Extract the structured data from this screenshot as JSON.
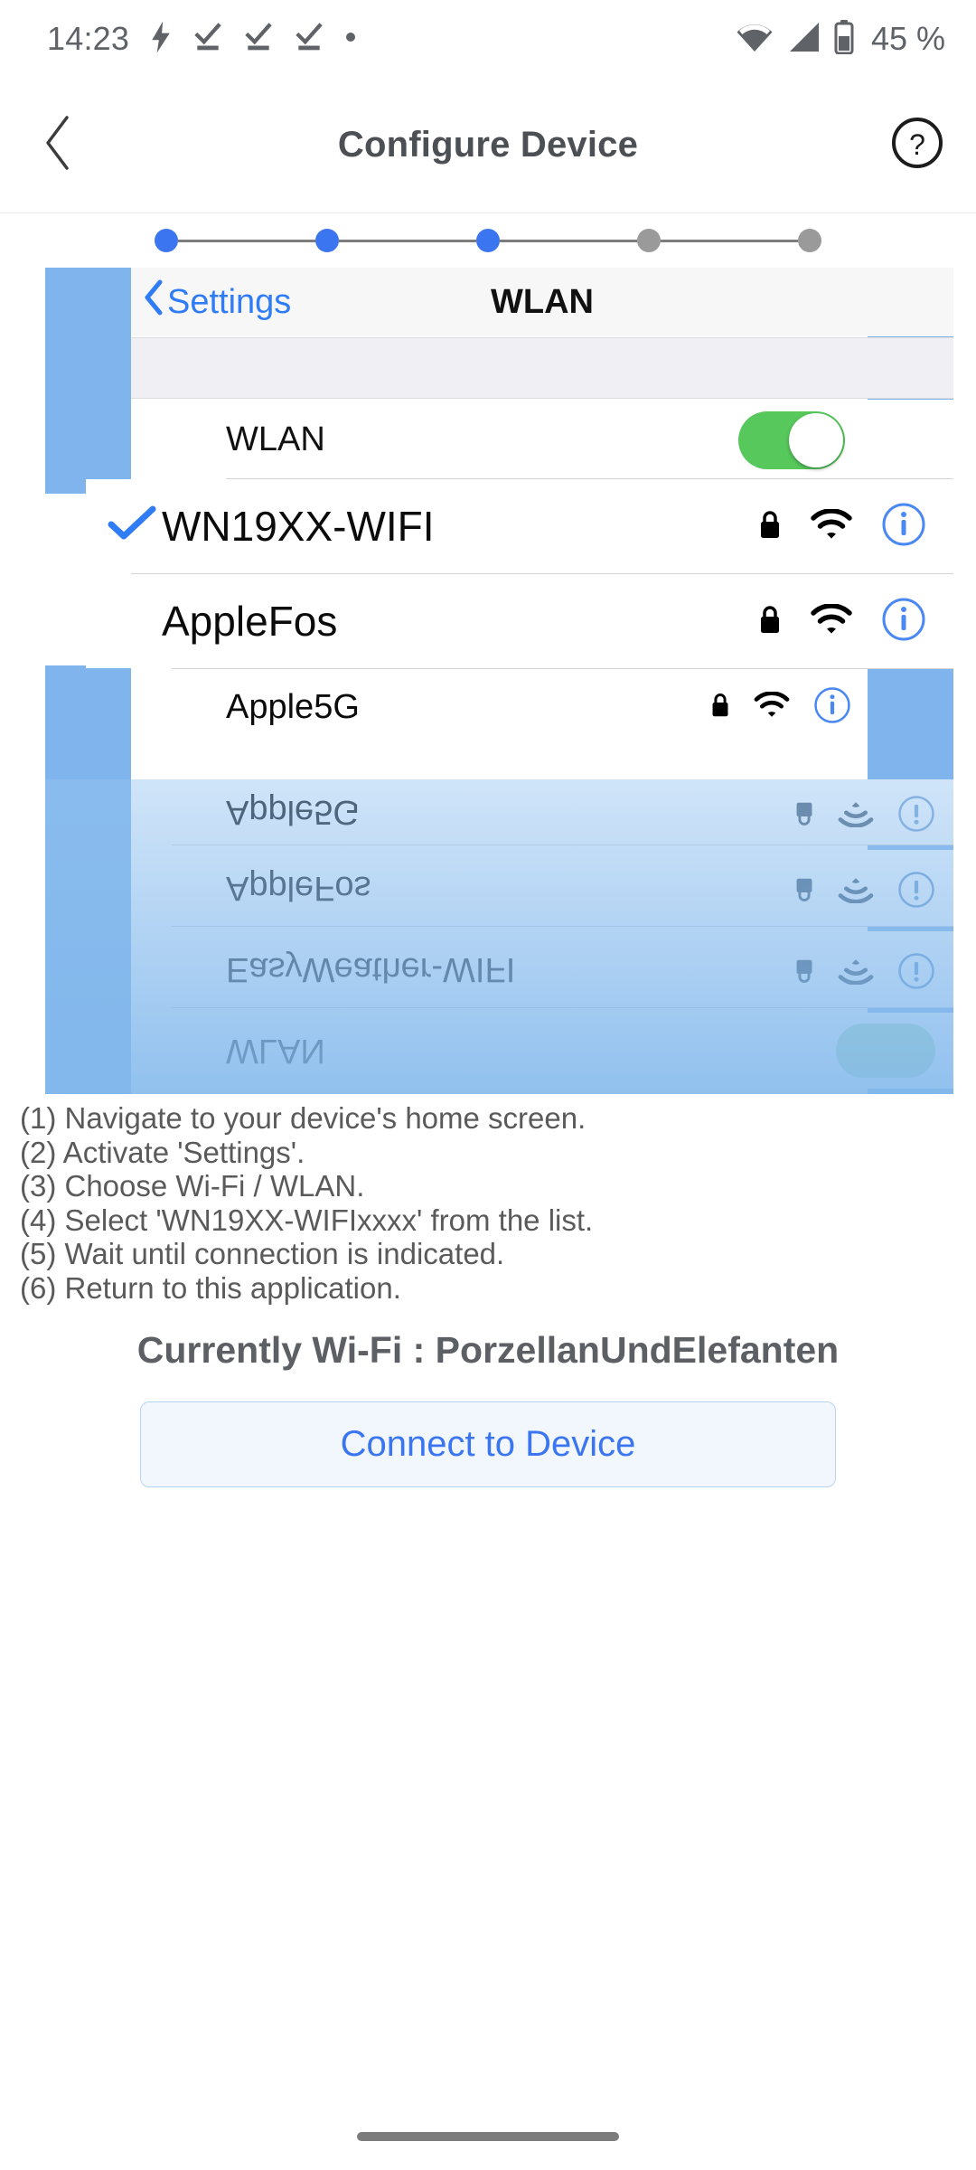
{
  "status_bar": {
    "time": "14:23",
    "battery_text": "45 %",
    "icons": [
      "charging-bolt-icon",
      "task-check-icon",
      "task-check-icon",
      "task-check-icon",
      "dot-icon",
      "wifi-icon",
      "cellular-signal-icon",
      "battery-icon"
    ]
  },
  "app_bar": {
    "back_icon": "chevron-left-icon",
    "title": "Configure Device",
    "help_icon": "help-circle-icon"
  },
  "stepper": {
    "total": 5,
    "active": 3,
    "states": [
      "on",
      "on",
      "on",
      "off",
      "off"
    ],
    "colors": {
      "active": "#3b76f0",
      "inactive": "#9a9a9a"
    }
  },
  "tutorial_image": {
    "ios_nav": {
      "back_label": "Settings",
      "title": "WLAN"
    },
    "wlan_row": {
      "label": "WLAN",
      "toggle_state": "on",
      "toggle_color": "#57c85c"
    },
    "networks": [
      {
        "ssid": "WN19XX-WIFI",
        "connected": true,
        "locked": true,
        "signal": "wifi-full-icon",
        "info": "info-circle-icon"
      },
      {
        "ssid": "AppleFos",
        "connected": false,
        "locked": true,
        "signal": "wifi-full-icon",
        "info": "info-circle-icon"
      },
      {
        "ssid": "Apple5G",
        "connected": false,
        "locked": true,
        "signal": "wifi-full-icon",
        "info": "info-circle-icon"
      }
    ],
    "reflection_networks": [
      {
        "ssid": "Apple5G"
      },
      {
        "ssid": "AppleFos"
      },
      {
        "ssid": "EasyWeather-WIFI"
      },
      {
        "ssid": "WLAN"
      }
    ],
    "frame_color": "#7fb4ec"
  },
  "instructions": [
    "(1) Navigate to your device's home screen.",
    "(2) Activate 'Settings'.",
    "(3) Choose Wi-Fi / WLAN.",
    "(4) Select 'WN19XX-WIFIxxxx' from the list.",
    "(5) Wait until connection is indicated.",
    "(6) Return to this application."
  ],
  "current_wifi": "Currently Wi-Fi : PorzellanUndElefanten",
  "connect_button": {
    "label": "Connect to Device",
    "color": "#3b76f0"
  },
  "nav_bar": {
    "gesture_pill": "home-gesture-pill"
  }
}
